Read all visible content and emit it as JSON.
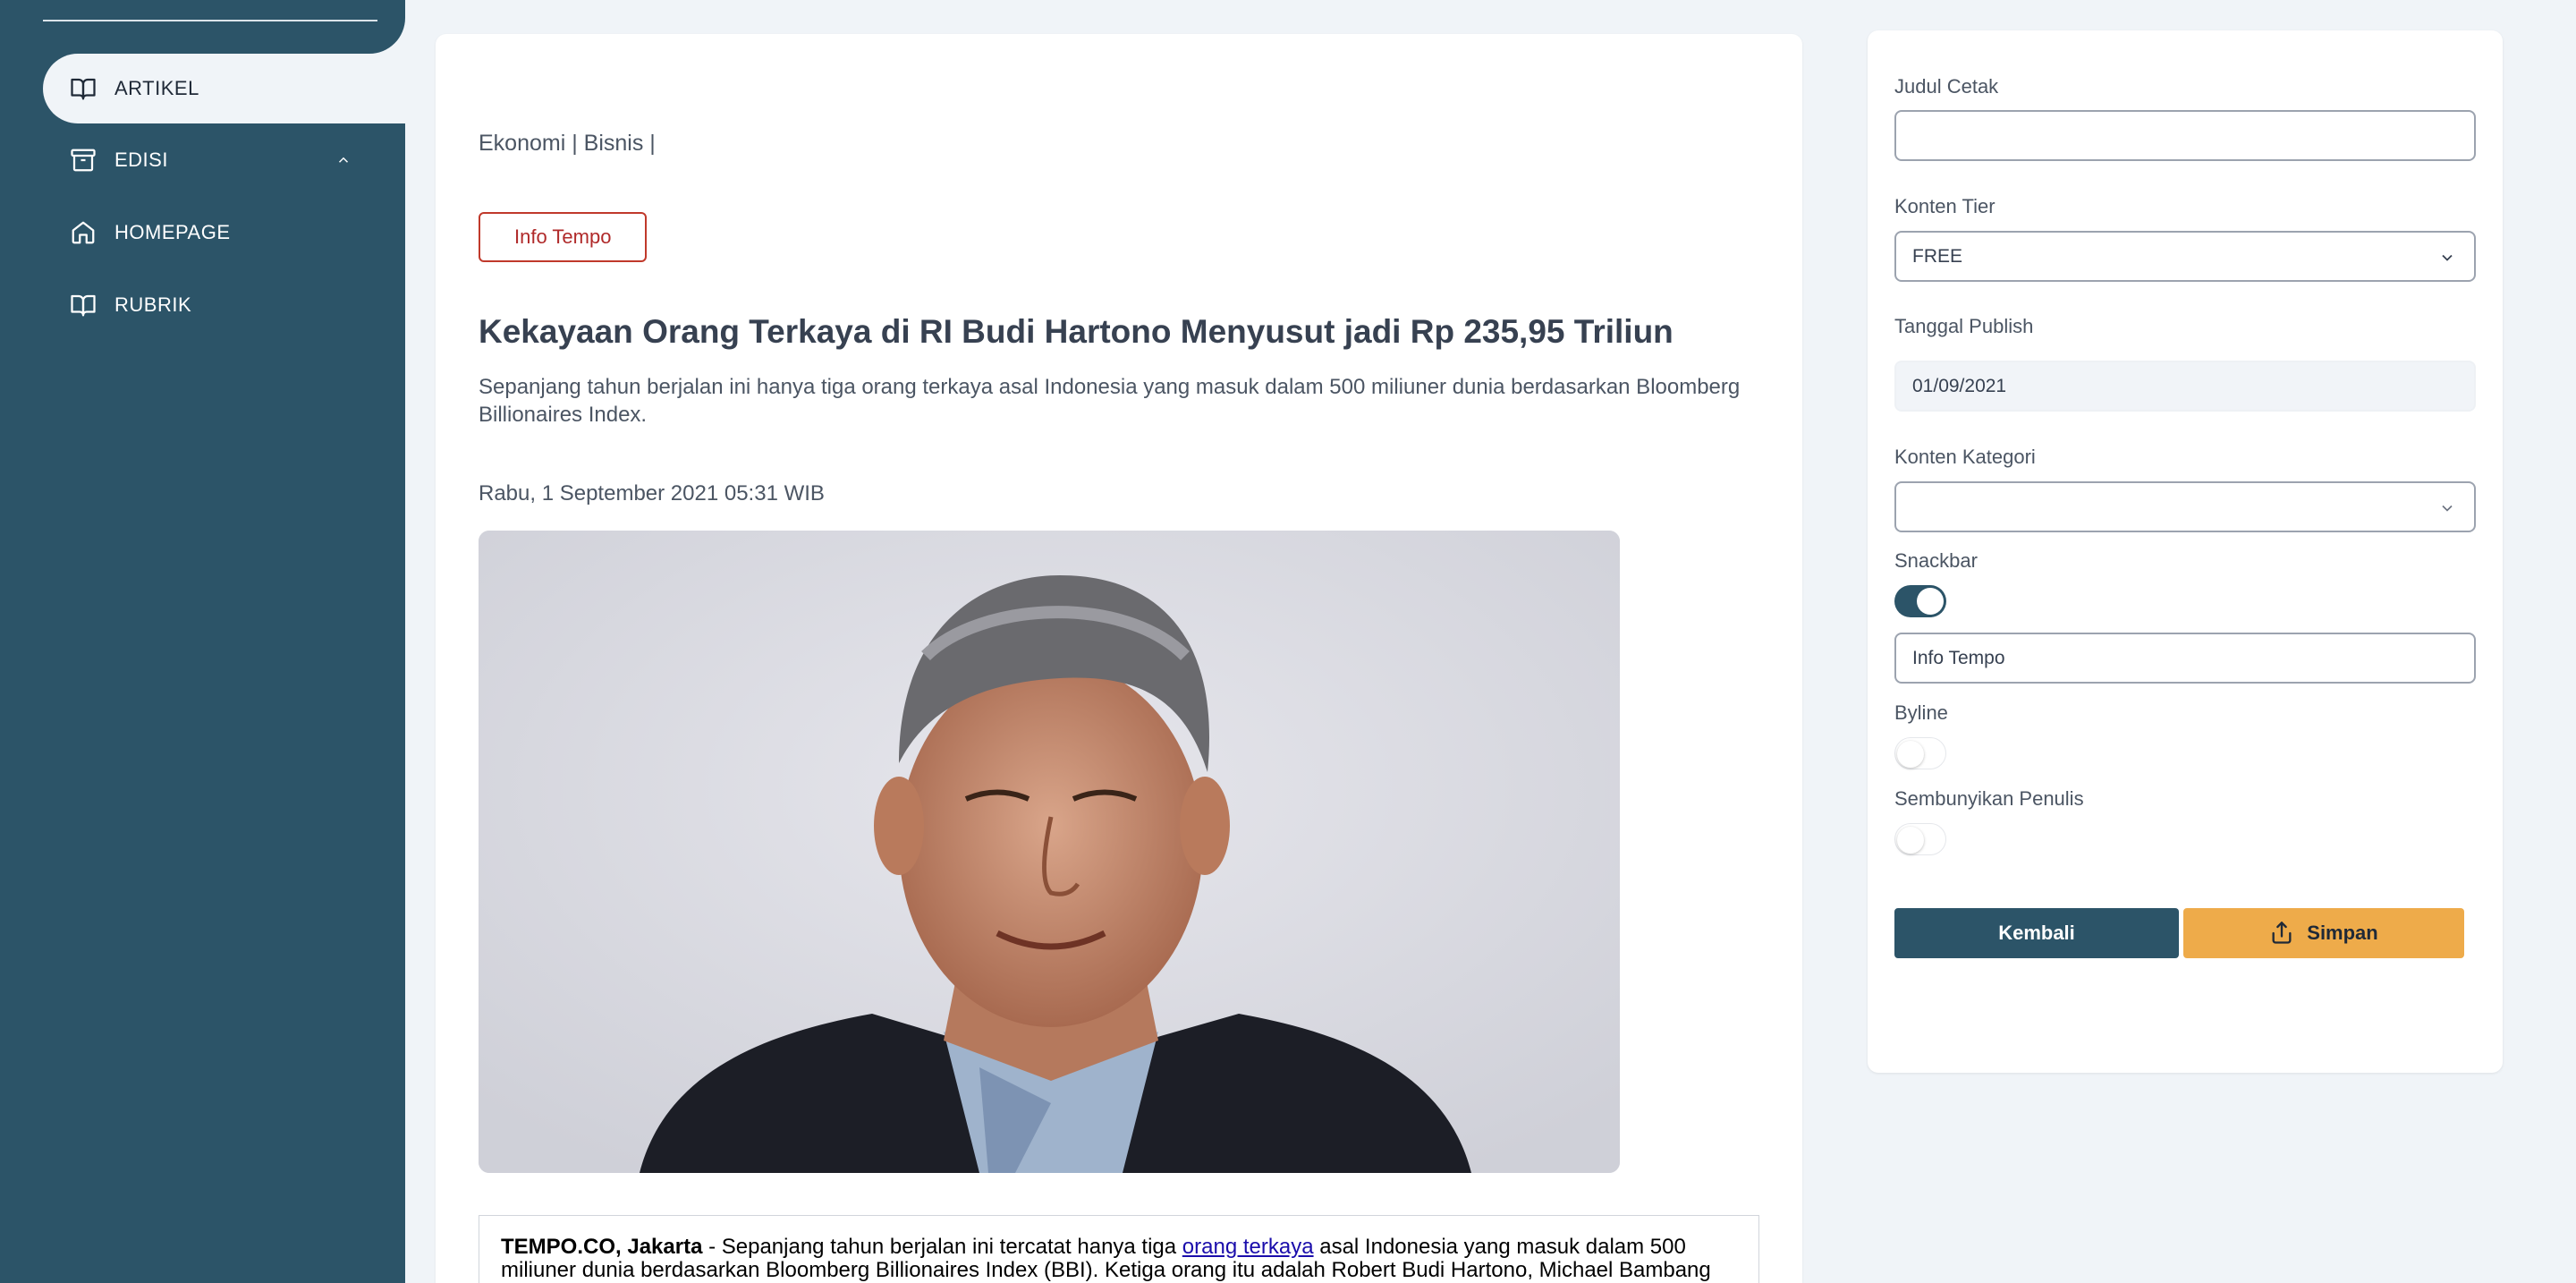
{
  "sidebar": {
    "items": [
      {
        "label": "ARTIKEL",
        "icon": "book-open-icon",
        "active": true
      },
      {
        "label": "EDISI",
        "icon": "archive-icon",
        "expanded": true
      },
      {
        "label": "HOMEPAGE",
        "icon": "home-icon"
      },
      {
        "label": "RUBRIK",
        "icon": "book-open-icon"
      }
    ]
  },
  "article": {
    "breadcrumb": "Ekonomi | Bisnis |",
    "snackbar_badge": "Info Tempo",
    "title": "Kekayaan Orang Terkaya di RI Budi Hartono Menyusut jadi Rp 235,95 Triliun",
    "lead": "Sepanjang tahun berjalan ini hanya tiga orang terkaya asal Indonesia yang masuk dalam 500 miliuner dunia berdasarkan Bloomberg Billionaires Index.",
    "date": "Rabu, 1 September 2021 05:31 WIB",
    "body": {
      "dateline": "TEMPO.CO, Jakarta",
      "text_before_link": " - Sepanjang tahun berjalan ini tercatat hanya tiga ",
      "link_text": "orang terkaya",
      "text_after_link": " asal Indonesia yang masuk dalam 500 miliuner dunia berdasarkan Bloomberg Billionaires Index (BBI). Ketiga orang itu adalah Robert Budi Hartono, Michael Bambang"
    }
  },
  "form": {
    "judul_cetak": {
      "label": "Judul Cetak",
      "value": ""
    },
    "konten_tier": {
      "label": "Konten Tier",
      "value": "FREE"
    },
    "tanggal_publish": {
      "label": "Tanggal Publish",
      "value": "01/09/2021"
    },
    "konten_kategori": {
      "label": "Konten Kategori",
      "value": ""
    },
    "snackbar": {
      "label": "Snackbar",
      "enabled": true,
      "value": "Info Tempo"
    },
    "byline": {
      "label": "Byline",
      "enabled": false
    },
    "sembunyikan_penulis": {
      "label": "Sembunyikan Penulis",
      "enabled": false
    },
    "back_label": "Kembali",
    "save_label": "Simpan"
  },
  "colors": {
    "sidebar": "#2c5468",
    "background": "#f0f4f8",
    "primary_button": "#2c5468",
    "save_button": "#eeab4a",
    "badge_border": "#c0392b"
  }
}
